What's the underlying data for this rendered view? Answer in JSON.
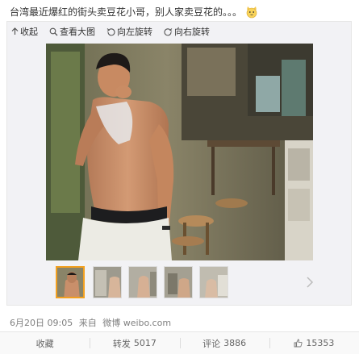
{
  "post": {
    "text": "台湾最近爆红的街头卖豆花小哥，别人家卖豆花的。。。",
    "emoji_icon": "cat-face-emoji-icon"
  },
  "toolbar": {
    "collapse": "收起",
    "view_large": "查看大图",
    "rotate_left": "向左旋转",
    "rotate_right": "向右旋转"
  },
  "thumbnails": {
    "count": 5,
    "active_index": 0
  },
  "meta": {
    "date": "6月20日 09:05",
    "source_prefix": "来自",
    "source": "微博 weibo.com"
  },
  "actions": {
    "favorite": "收藏",
    "repost": "转发",
    "repost_count": "5017",
    "comment": "评论",
    "comment_count": "3886",
    "like_count": "15353"
  },
  "colors": {
    "active_thumb_border": "#f2a020",
    "meta_gray": "#808080"
  }
}
